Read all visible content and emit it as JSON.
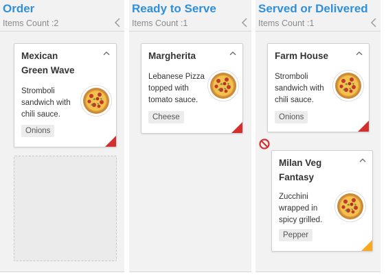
{
  "columns": [
    {
      "title": "Order",
      "count": "Items Count :2",
      "cards": [
        {
          "title_line1": "Mexican",
          "title_line2": "Green Wave",
          "desc": [
            "Stromboli",
            "sandwich with",
            "chili sauce."
          ],
          "tag": "Onions",
          "priority_color": "#d32f2f"
        }
      ]
    },
    {
      "title": "Ready to Serve",
      "count": "Items Count :1",
      "cards": [
        {
          "title_line1": "Margherita",
          "desc": [
            "Lebanese Pizza",
            "topped with",
            "tomato sauce."
          ],
          "tag": "Cheese",
          "priority_color": "#d32f2f"
        }
      ]
    },
    {
      "title": "Served or Delivered",
      "count": "Items Count :1",
      "cards": [
        {
          "title_line1": "Farm House",
          "desc": [
            "Stromboli",
            "sandwich with",
            "chili sauce."
          ],
          "tag": "Onions",
          "priority_color": "#d32f2f"
        },
        {
          "title_line1": "Milan Veg",
          "title_line2": "Fantasy",
          "desc": [
            "Zucchini",
            "wrapped in",
            "spicy grilled."
          ],
          "tag": "Pepper",
          "priority_color": "#f9a825"
        }
      ]
    }
  ],
  "icons": {
    "collapse": "chevron-left-icon",
    "card_toggle": "chevron-up-icon",
    "drop_blocked": "no-entry-icon",
    "pizza": "pizza-image"
  },
  "colors": {
    "header_text": "#2f8fd8",
    "column_bg": "#f2f2f2",
    "priority_high": "#d32f2f",
    "priority_medium": "#f9a825",
    "no_entry": "#d32f2f"
  }
}
